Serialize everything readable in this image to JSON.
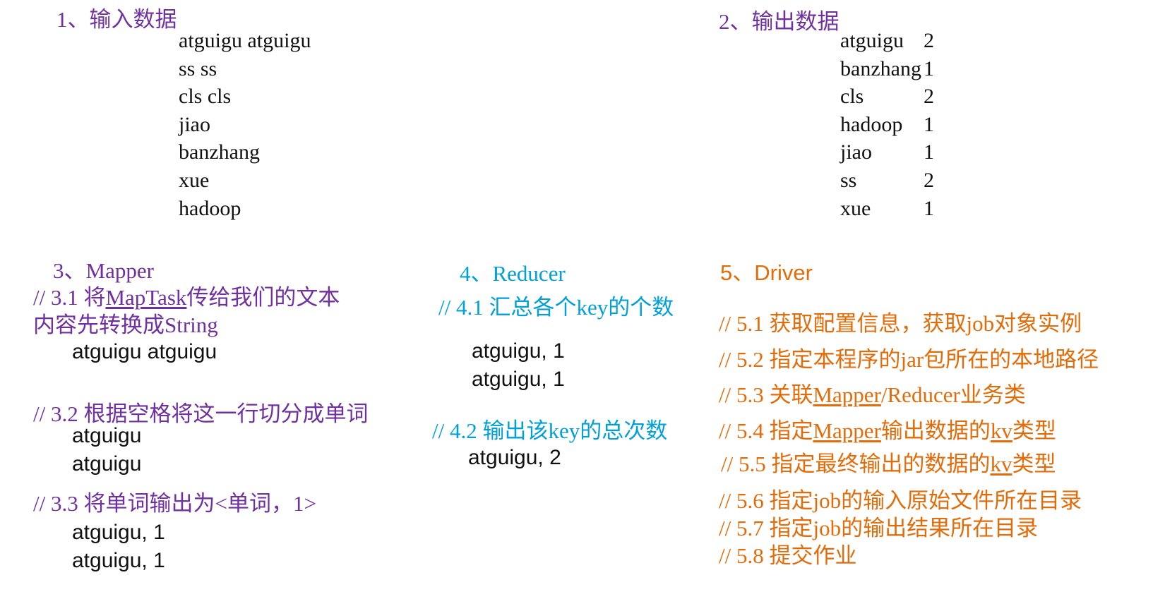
{
  "section1": {
    "heading": "1、输入数据",
    "lines": [
      "atguigu atguigu",
      "ss ss",
      "cls cls",
      "jiao",
      "banzhang",
      "xue",
      "hadoop"
    ]
  },
  "section2": {
    "heading": "2、输出数据",
    "rows": [
      {
        "key": "atguigu",
        "value": "2"
      },
      {
        "key": "banzhang",
        "value": "1"
      },
      {
        "key": "cls",
        "value": "2"
      },
      {
        "key": "hadoop",
        "value": "1"
      },
      {
        "key": "jiao",
        "value": "1"
      },
      {
        "key": "ss",
        "value": "2"
      },
      {
        "key": "xue",
        "value": "1"
      }
    ]
  },
  "section3": {
    "heading": "3、Mapper",
    "c31_prefix": "//  3.1  将",
    "c31_link": "MapTask",
    "c31_suffix": "传给我们的文本",
    "c31_line2": "内容先转换成String",
    "sample1": "atguigu atguigu",
    "c32": "// 3.2 根据空格将这一行切分成单词",
    "sample2": [
      "atguigu",
      "atguigu"
    ],
    "c33": "// 3.3 将单词输出为<单词，1>",
    "sample3": [
      "atguigu, 1",
      "atguigu, 1"
    ]
  },
  "section4": {
    "heading": "4、Reducer",
    "c41": "// 4.1 汇总各个key的个数",
    "sample1": [
      "atguigu, 1",
      "atguigu, 1"
    ],
    "c42": "// 4.2  输出该key的总次数",
    "sample2": "atguigu, 2"
  },
  "section5": {
    "heading": "5、Driver",
    "c51": "// 5.1 获取配置信息，获取job对象实例",
    "c52": "// 5.2 指定本程序的jar包所在的本地路径",
    "c53_prefix": "// 5.3 关联",
    "c53_link": "Mapper",
    "c53_suffix": "/Reducer业务类",
    "c54_prefix": "// 5.4 指定",
    "c54_link": "Mapper",
    "c54_mid": "输出数据的",
    "c54_link2": "kv",
    "c54_suffix": "类型",
    "c55_prefix": "// 5.5 指定最终输出的数据的",
    "c55_link": "kv",
    "c55_suffix": "类型",
    "c56": "// 5.6 指定job的输入原始文件所在目录",
    "c57": "// 5.7  指定job的输出结果所在目录",
    "c58": "// 5.8 提交作业"
  },
  "colors": {
    "purple": "#7030a0",
    "blue": "#00a0d8",
    "orange": "#e36c09"
  }
}
